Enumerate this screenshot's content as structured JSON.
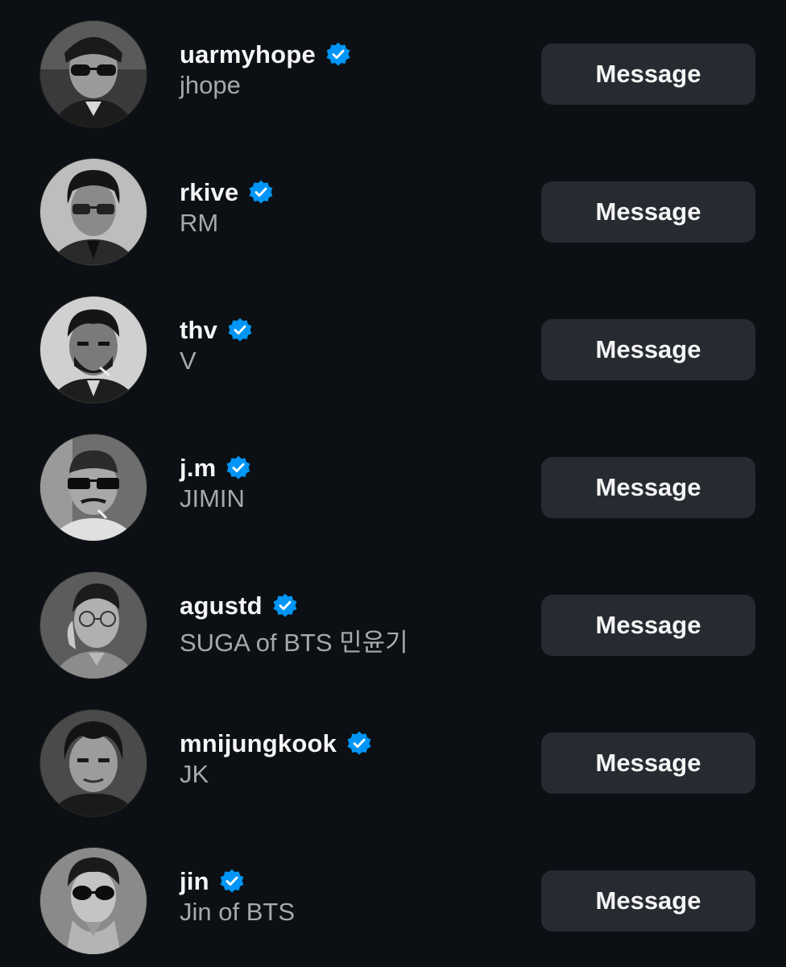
{
  "accent": "#0095f6",
  "users": [
    {
      "handle": "uarmyhope",
      "name": "jhope",
      "verified": true,
      "action": "Message",
      "avatar": "profile-photo"
    },
    {
      "handle": "rkive",
      "name": "RM",
      "verified": true,
      "action": "Message",
      "avatar": "profile-photo"
    },
    {
      "handle": "thv",
      "name": "V",
      "verified": true,
      "action": "Message",
      "avatar": "profile-photo"
    },
    {
      "handle": "j.m",
      "name": "JIMIN",
      "verified": true,
      "action": "Message",
      "avatar": "profile-photo"
    },
    {
      "handle": "agustd",
      "name": "SUGA of BTS 민윤기",
      "verified": true,
      "action": "Message",
      "avatar": "profile-photo"
    },
    {
      "handle": "mnijungkook",
      "name": "JK",
      "verified": true,
      "action": "Message",
      "avatar": "profile-photo"
    },
    {
      "handle": "jin",
      "name": "Jin of BTS",
      "verified": true,
      "action": "Message",
      "avatar": "profile-photo"
    }
  ]
}
